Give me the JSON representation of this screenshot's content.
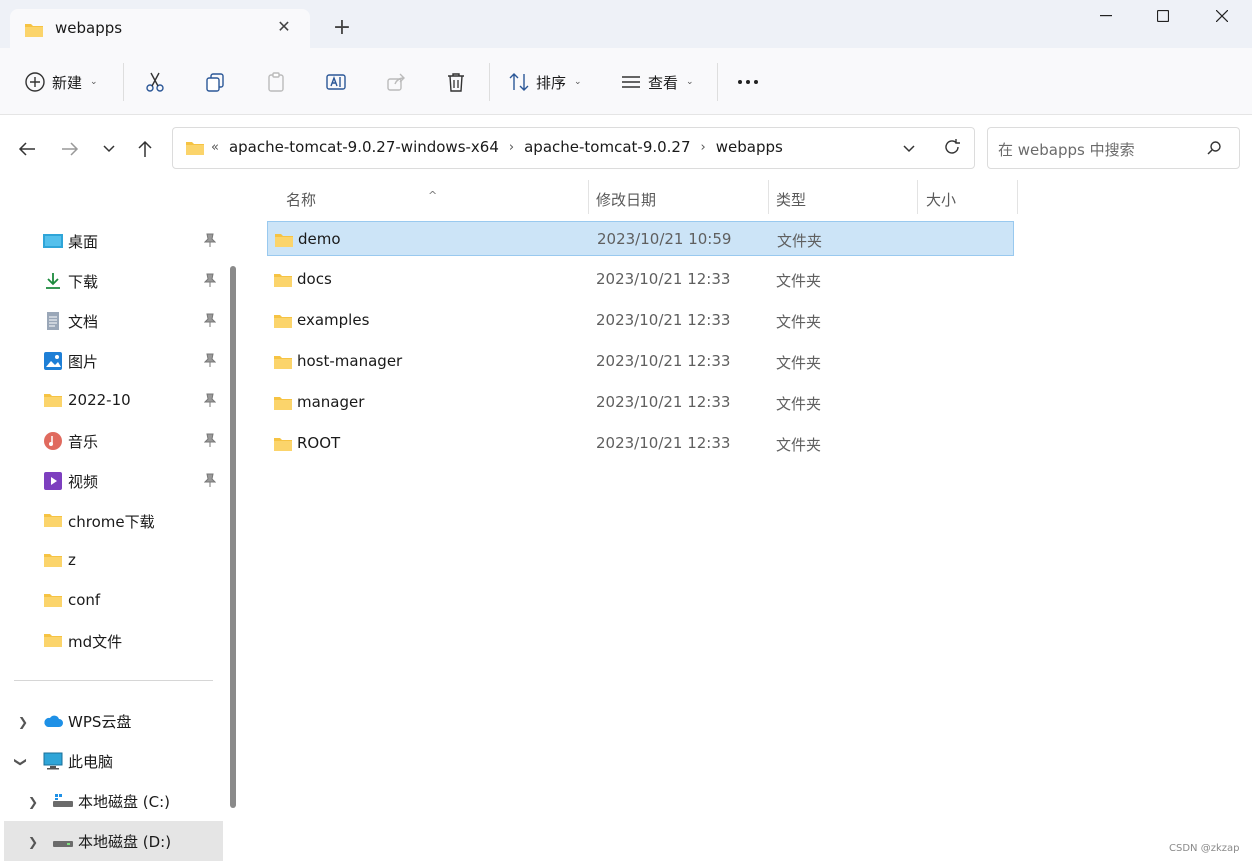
{
  "tab": {
    "title": "webapps"
  },
  "toolbar": {
    "new_label": "新建",
    "sort_label": "排序",
    "view_label": "查看"
  },
  "address": {
    "crumbs": [
      "apache-tomcat-9.0.27-windows-x64",
      "apache-tomcat-9.0.27",
      "webapps"
    ],
    "overflow": "«"
  },
  "search": {
    "placeholder": "在 webapps 中搜索"
  },
  "sidebar": {
    "quick_access": [
      {
        "label": "桌面",
        "icon": "desktop-icon",
        "pinned": true
      },
      {
        "label": "下载",
        "icon": "download-icon",
        "pinned": true
      },
      {
        "label": "文档",
        "icon": "document-icon",
        "pinned": true
      },
      {
        "label": "图片",
        "icon": "pictures-icon",
        "pinned": true
      },
      {
        "label": "2022-10",
        "icon": "folder-icon",
        "pinned": true
      },
      {
        "label": "音乐",
        "icon": "music-icon",
        "pinned": true
      },
      {
        "label": "视频",
        "icon": "video-icon",
        "pinned": true
      },
      {
        "label": "chrome下载",
        "icon": "folder-icon",
        "pinned": false
      },
      {
        "label": "z",
        "icon": "folder-icon",
        "pinned": false
      },
      {
        "label": "conf",
        "icon": "folder-icon",
        "pinned": false
      },
      {
        "label": "md文件",
        "icon": "folder-icon",
        "pinned": false
      }
    ],
    "tree": [
      {
        "label": "WPS云盘",
        "icon": "cloud-icon"
      },
      {
        "label": "此电脑",
        "icon": "computer-icon"
      },
      {
        "label": "本地磁盘 (C:)",
        "icon": "drive-icon"
      },
      {
        "label": "本地磁盘 (D:)",
        "icon": "drive-icon"
      }
    ]
  },
  "columns": {
    "name": "名称",
    "modified": "修改日期",
    "type": "类型",
    "size": "大小"
  },
  "files": [
    {
      "name": "demo",
      "modified": "2023/10/21 10:59",
      "type": "文件夹",
      "selected": true
    },
    {
      "name": "docs",
      "modified": "2023/10/21 12:33",
      "type": "文件夹"
    },
    {
      "name": "examples",
      "modified": "2023/10/21 12:33",
      "type": "文件夹"
    },
    {
      "name": "host-manager",
      "modified": "2023/10/21 12:33",
      "type": "文件夹"
    },
    {
      "name": "manager",
      "modified": "2023/10/21 12:33",
      "type": "文件夹"
    },
    {
      "name": "ROOT",
      "modified": "2023/10/21 12:33",
      "type": "文件夹"
    }
  ],
  "watermark": "CSDN @zkzap",
  "colors": {
    "selection": "#cce4f7",
    "folder": "#f6c343",
    "accent": "#0067c0"
  }
}
